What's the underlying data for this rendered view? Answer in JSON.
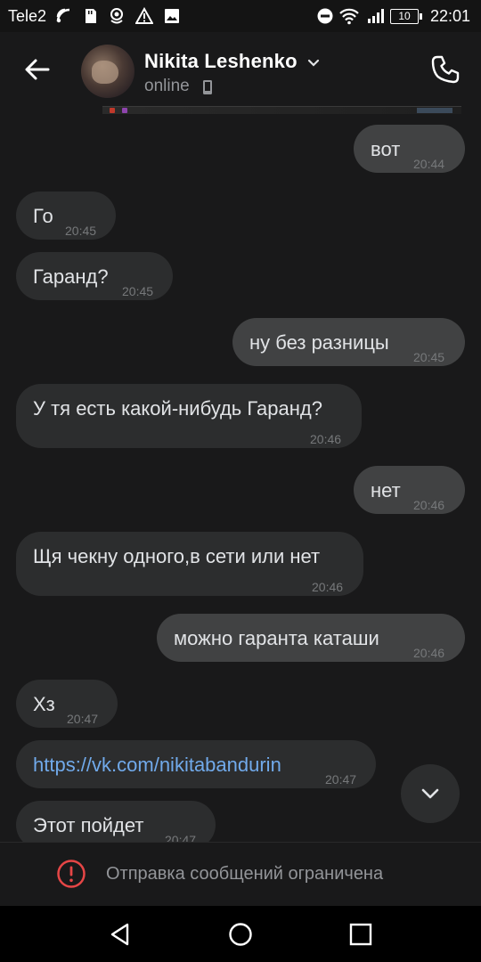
{
  "status_bar": {
    "carrier": "Tele2",
    "battery": "10",
    "time": "22:01"
  },
  "header": {
    "name": "Nikita Leshenko",
    "status": "online"
  },
  "messages": [
    {
      "dir": "out",
      "text": "вот",
      "time": "20:44"
    },
    {
      "dir": "in",
      "text": "Го",
      "time": "20:45"
    },
    {
      "dir": "in",
      "text": "Гаранд?",
      "time": "20:45"
    },
    {
      "dir": "out",
      "text": "ну без разницы",
      "time": "20:45"
    },
    {
      "dir": "in",
      "text": "У тя есть какой-нибудь Гаранд?",
      "time": "20:46"
    },
    {
      "dir": "out",
      "text": "нет",
      "time": "20:46"
    },
    {
      "dir": "in",
      "text": "Щя чекну одного,в сети или нет",
      "time": "20:46"
    },
    {
      "dir": "out",
      "text": "можно гаранта каташи",
      "time": "20:46"
    },
    {
      "dir": "in",
      "text": "Хз",
      "time": "20:47"
    },
    {
      "dir": "in",
      "text": "https://vk.com/nikitabandurin",
      "time": "20:47",
      "link": true
    },
    {
      "dir": "in",
      "text": "Этот пойдет",
      "time": "20:47"
    }
  ],
  "composer": {
    "restriction_text": "Отправка сообщений ограничена"
  },
  "colors": {
    "background": "#19191a",
    "bubble_in": "#2c2d2e",
    "bubble_out": "#414243",
    "link": "#71aaeb",
    "warning": "#e64646"
  }
}
